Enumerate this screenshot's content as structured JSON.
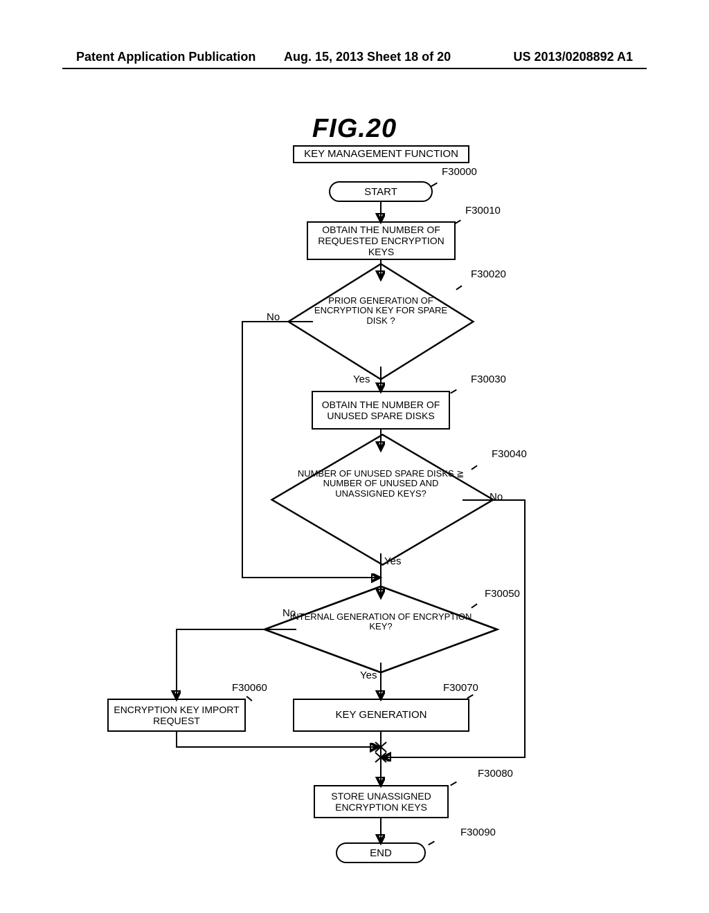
{
  "header": {
    "left": "Patent Application Publication",
    "center": "Aug. 15, 2013  Sheet 18 of 20",
    "right": "US 2013/0208892 A1"
  },
  "figure": {
    "title": "FIG.20",
    "subtitle": "KEY MANAGEMENT FUNCTION"
  },
  "nodes": {
    "start": {
      "text": "START",
      "ref": "F30000"
    },
    "obtain_req": {
      "text": "OBTAIN THE NUMBER OF REQUESTED ENCRYPTION KEYS",
      "ref": "F30010"
    },
    "prior_gen": {
      "text": "PRIOR GENERATION OF ENCRYPTION KEY FOR SPARE DISK ?",
      "ref": "F30020",
      "yes": "Yes",
      "no": "No"
    },
    "obtain_spare": {
      "text": "OBTAIN THE NUMBER OF UNUSED SPARE DISKS",
      "ref": "F30030"
    },
    "compare": {
      "text": "NUMBER OF UNUSED SPARE DISKS ≧ NUMBER OF UNUSED AND UNASSIGNED KEYS?",
      "ref": "F30040",
      "yes": "Yes",
      "no": "No"
    },
    "internal": {
      "text": "INTERNAL GENERATION OF ENCRYPTION KEY?",
      "ref": "F30050",
      "yes": "Yes",
      "no": "No"
    },
    "import_req": {
      "text": "ENCRYPTION KEY IMPORT REQUEST",
      "ref": "F30060"
    },
    "key_gen": {
      "text": "KEY GENERATION",
      "ref": "F30070"
    },
    "store": {
      "text": "STORE UNASSIGNED ENCRYPTION KEYS",
      "ref": "F30080"
    },
    "end": {
      "text": "END",
      "ref": "F30090"
    }
  }
}
